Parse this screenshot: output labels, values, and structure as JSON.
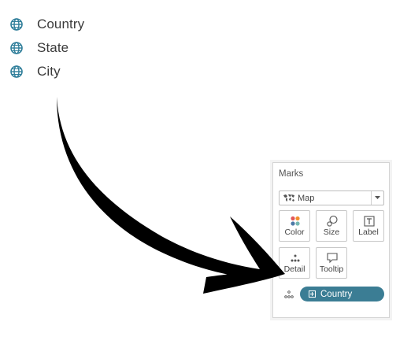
{
  "fields": [
    {
      "label": "Country",
      "icon": "globe-icon"
    },
    {
      "label": "State",
      "icon": "globe-icon"
    },
    {
      "label": "City",
      "icon": "globe-icon"
    }
  ],
  "marks": {
    "title": "Marks",
    "mark_type": "Map",
    "mark_type_icon": "map-icon",
    "buttons": [
      {
        "label": "Color",
        "icon": "color-icon"
      },
      {
        "label": "Size",
        "icon": "size-icon"
      },
      {
        "label": "Label",
        "icon": "label-icon"
      },
      {
        "label": "Detail",
        "icon": "detail-icon"
      },
      {
        "label": "Tooltip",
        "icon": "tooltip-icon"
      }
    ],
    "pill": {
      "label": "Country",
      "icon": "detail-icon"
    }
  },
  "colors": {
    "pill": "#3b7d94",
    "globe": "#2f7e9a",
    "arrow": "#000000"
  }
}
